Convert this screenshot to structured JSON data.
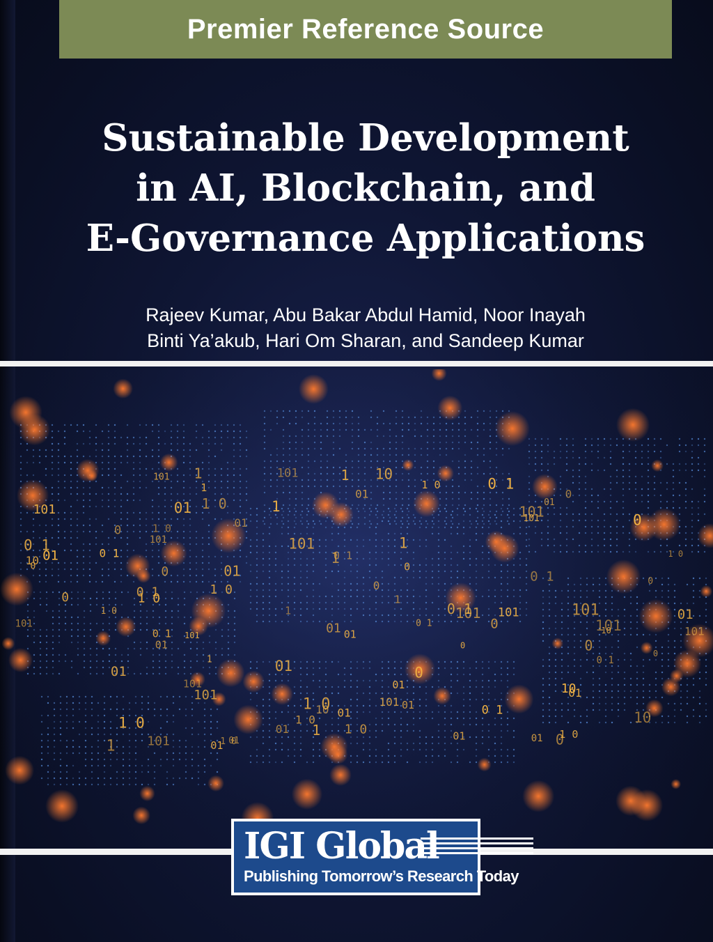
{
  "banner": {
    "label": "Premier Reference Source",
    "color": "#7c8a55"
  },
  "title": {
    "line1": "Sustainable Development",
    "line2": "in AI, Blockchain, and",
    "line3": "E-Governance Applications"
  },
  "authors": {
    "line1": "Rajeev Kumar, Abu Bakar Abdul Hamid, Noor Inayah",
    "line2": "Binti Ya’akub, Hari Om Sharan, and Sandeep Kumar"
  },
  "publisher": {
    "name": "IGI Global",
    "tagline": "Publishing Tomorrow’s Research Today",
    "color": "#1d4a8c"
  },
  "artwork": {
    "glyphs": [
      "0",
      "1",
      "10",
      "01",
      "101",
      "0 1",
      "1 0"
    ],
    "colors": {
      "background": "#0f1634",
      "grid_dot": "#4f7fc8",
      "glyph": "#f5b544",
      "glow": "#ff7a2e"
    }
  }
}
